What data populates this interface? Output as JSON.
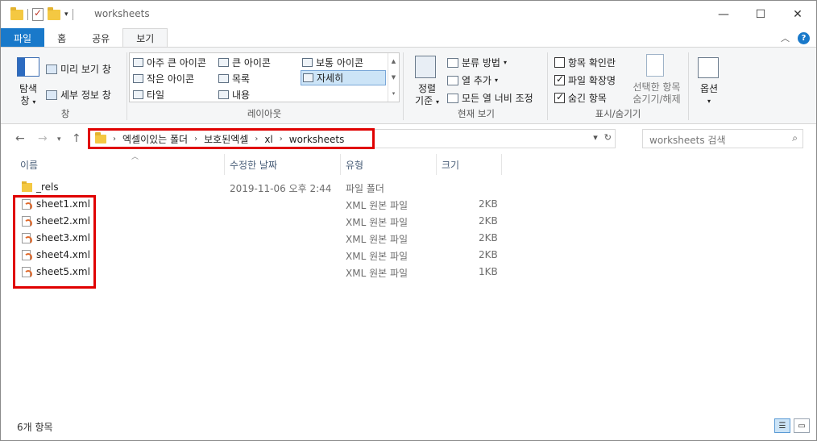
{
  "window": {
    "title": "worksheets",
    "controls": {
      "minimize": "—",
      "maximize": "☐",
      "close": "✕"
    }
  },
  "ribbon_tabs": [
    {
      "label": "파일"
    },
    {
      "label": "홈"
    },
    {
      "label": "공유"
    },
    {
      "label": "보기"
    }
  ],
  "ribbon": {
    "pane_group": {
      "nav_pane_label1": "탐색",
      "nav_pane_label2": "창",
      "preview_label": "미리 보기 창",
      "details_label": "세부 정보 창",
      "group_label": "창"
    },
    "layout_group": {
      "items": [
        "아주 큰 아이콘",
        "큰 아이콘",
        "보통 아이콘",
        "작은 아이콘",
        "목록",
        "자세히",
        "타일",
        "내용"
      ],
      "selected": "자세히",
      "group_label": "레이아웃"
    },
    "current_view_group": {
      "sort_label1": "정렬",
      "sort_label2": "기준",
      "group_by_label": "분류 방법",
      "add_columns_label": "열 추가",
      "fit_columns_label": "모든 열 너비 조정",
      "group_label": "현재 보기"
    },
    "show_hide_group": {
      "item_checkboxes_label": "항목 확인란",
      "item_checkboxes_checked": false,
      "file_extensions_label": "파일 확장명",
      "file_extensions_checked": true,
      "hidden_items_label": "숨긴 항목",
      "hidden_items_checked": true,
      "hide_selected_label1": "선택한 항목",
      "hide_selected_label2": "숨기기/해제",
      "group_label": "표시/숨기기"
    },
    "options_label": "옵션"
  },
  "address_bar": {
    "crumbs": [
      "엑셀이있는 폴더",
      "보호된엑셀",
      "xl",
      "worksheets"
    ]
  },
  "search": {
    "placeholder": "worksheets 검색"
  },
  "columns": [
    "이름",
    "수정한 날짜",
    "유형",
    "크기"
  ],
  "files": [
    {
      "name": "_rels",
      "date": "2019-11-06 오후 2:44",
      "type": "파일 폴더",
      "size": "",
      "icon": "folder-icon"
    },
    {
      "name": "sheet1.xml",
      "date": "",
      "type": "XML 원본 파일",
      "size": "2KB",
      "icon": "xml-file-icon"
    },
    {
      "name": "sheet2.xml",
      "date": "",
      "type": "XML 원본 파일",
      "size": "2KB",
      "icon": "xml-file-icon"
    },
    {
      "name": "sheet3.xml",
      "date": "",
      "type": "XML 원본 파일",
      "size": "2KB",
      "icon": "xml-file-icon"
    },
    {
      "name": "sheet4.xml",
      "date": "",
      "type": "XML 원본 파일",
      "size": "2KB",
      "icon": "xml-file-icon"
    },
    {
      "name": "sheet5.xml",
      "date": "",
      "type": "XML 원본 파일",
      "size": "1KB",
      "icon": "xml-file-icon"
    }
  ],
  "status": {
    "item_count": "6개 항목"
  },
  "colors": {
    "file_tab": "#1979ca",
    "highlight": "#e00000",
    "selected_layout": "#cce4f7"
  }
}
